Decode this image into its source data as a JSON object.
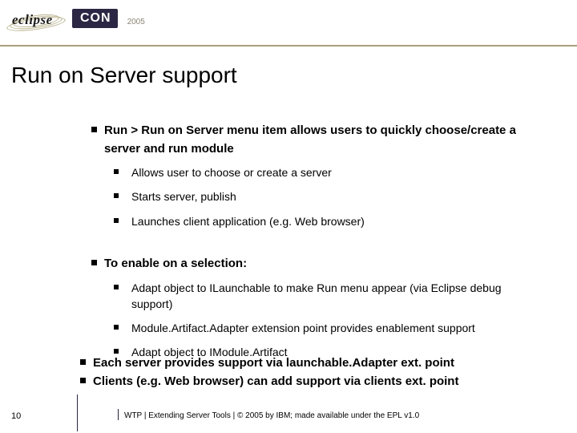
{
  "header": {
    "logo_text": "eclipse",
    "con_label": "CON",
    "year": "2005"
  },
  "title": "Run on Server support",
  "section1": {
    "heading": "Run > Run on Server menu item allows users to quickly choose/create a server and run module",
    "subs": [
      "Allows user to choose or create a server",
      "Starts server, publish",
      "Launches client application (e.g. Web browser)"
    ]
  },
  "section2": {
    "heading": "To enable on a selection:",
    "subs": [
      "Adapt object to ILaunchable to make Run menu appear (via Eclipse debug support)",
      "Module.Artifact.Adapter extension point provides enablement support",
      "Adapt object to IModule.Artifact"
    ]
  },
  "section3": {
    "b1": "Each server provides support via launchable.Adapter ext. point",
    "b2": "Clients (e.g. Web browser) can add support via clients ext. point"
  },
  "footer": {
    "slide_num": "10",
    "text": "WTP  |  Extending Server Tools  |  © 2005 by IBM; made available under the EPL v1.0"
  }
}
